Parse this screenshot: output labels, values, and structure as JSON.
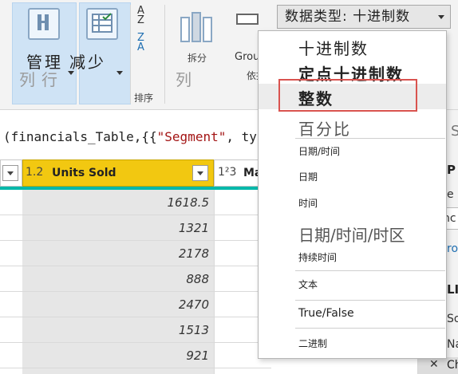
{
  "ribbon": {
    "manage_label": "管理",
    "reduce_label": "减少",
    "columns_label_1": "列",
    "rows_label": "行",
    "sort_label": "排序",
    "split_label": "拆分",
    "columns_label_2": "列",
    "group_label": "Grou",
    "by_label": "依据",
    "data_type_combo": "数据类型: 十进制数"
  },
  "formula": {
    "prefix": "(financials_Table,{{",
    "string": "\"Segment\"",
    "suffix": ", ty"
  },
  "grid": {
    "units_type": "1.2",
    "units_name": "Units Sold",
    "next_type": "1²3",
    "next_name": "Ma",
    "values": [
      "1618.5",
      "1321",
      "2178",
      "888",
      "2470",
      "1513",
      "921"
    ]
  },
  "menu": {
    "items": [
      {
        "label": "十进制数"
      },
      {
        "label": "定点十进制数"
      },
      {
        "label": "整数"
      },
      {
        "label": "百分比"
      },
      {
        "label": "日期/时间"
      },
      {
        "label": "日期"
      },
      {
        "label": "时间"
      },
      {
        "label": "日期/时间/时区"
      },
      {
        "label": "持续时间"
      },
      {
        "label": "文本"
      },
      {
        "label": "True/False"
      },
      {
        "label": "二进制"
      }
    ]
  },
  "right_pane": {
    "p1": "S",
    "p2": "P",
    "p3": "e",
    "p4": "nc",
    "p5": "ro",
    "p6": "LI",
    "p7": "So",
    "p8": "Na",
    "p9": "Ch",
    "close_glyph": "✕"
  },
  "colors": {
    "header_accent": "#f2c811",
    "teal_strip": "#01b8aa",
    "selection_outline": "#d9534f"
  },
  "icons": [
    "manage-columns-icon",
    "reduce-rows-icon",
    "sort-ascending-icon",
    "sort-descending-icon",
    "split-column-icon",
    "group-by-icon",
    "dropdown-caret-icon",
    "close-icon"
  ]
}
